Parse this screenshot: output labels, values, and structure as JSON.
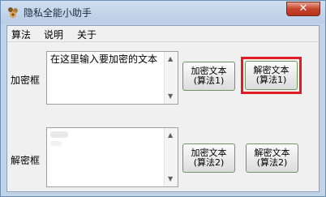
{
  "window": {
    "title": "隐私全能小助手",
    "close_glyph": "✕"
  },
  "menu": {
    "items": [
      "算法",
      "说明",
      "关于"
    ]
  },
  "encrypt": {
    "label": "加密框",
    "text": "在这里输入要加密的文本"
  },
  "decrypt": {
    "label": "解密框",
    "text": ""
  },
  "buttons": {
    "encrypt_algo1": [
      "加密文本",
      "(算法1)"
    ],
    "decrypt_algo1": [
      "解密文本",
      "(算法1)"
    ],
    "encrypt_algo2": [
      "加密文本",
      "(算法2)"
    ],
    "decrypt_algo2": [
      "解密文本",
      "(算法2)"
    ]
  },
  "scroll": {
    "up_glyph": "▲",
    "down_glyph": "▼"
  },
  "colors": {
    "highlight": "#e31b22",
    "button_border": "#6f9460",
    "close_button": "#c7442c"
  }
}
